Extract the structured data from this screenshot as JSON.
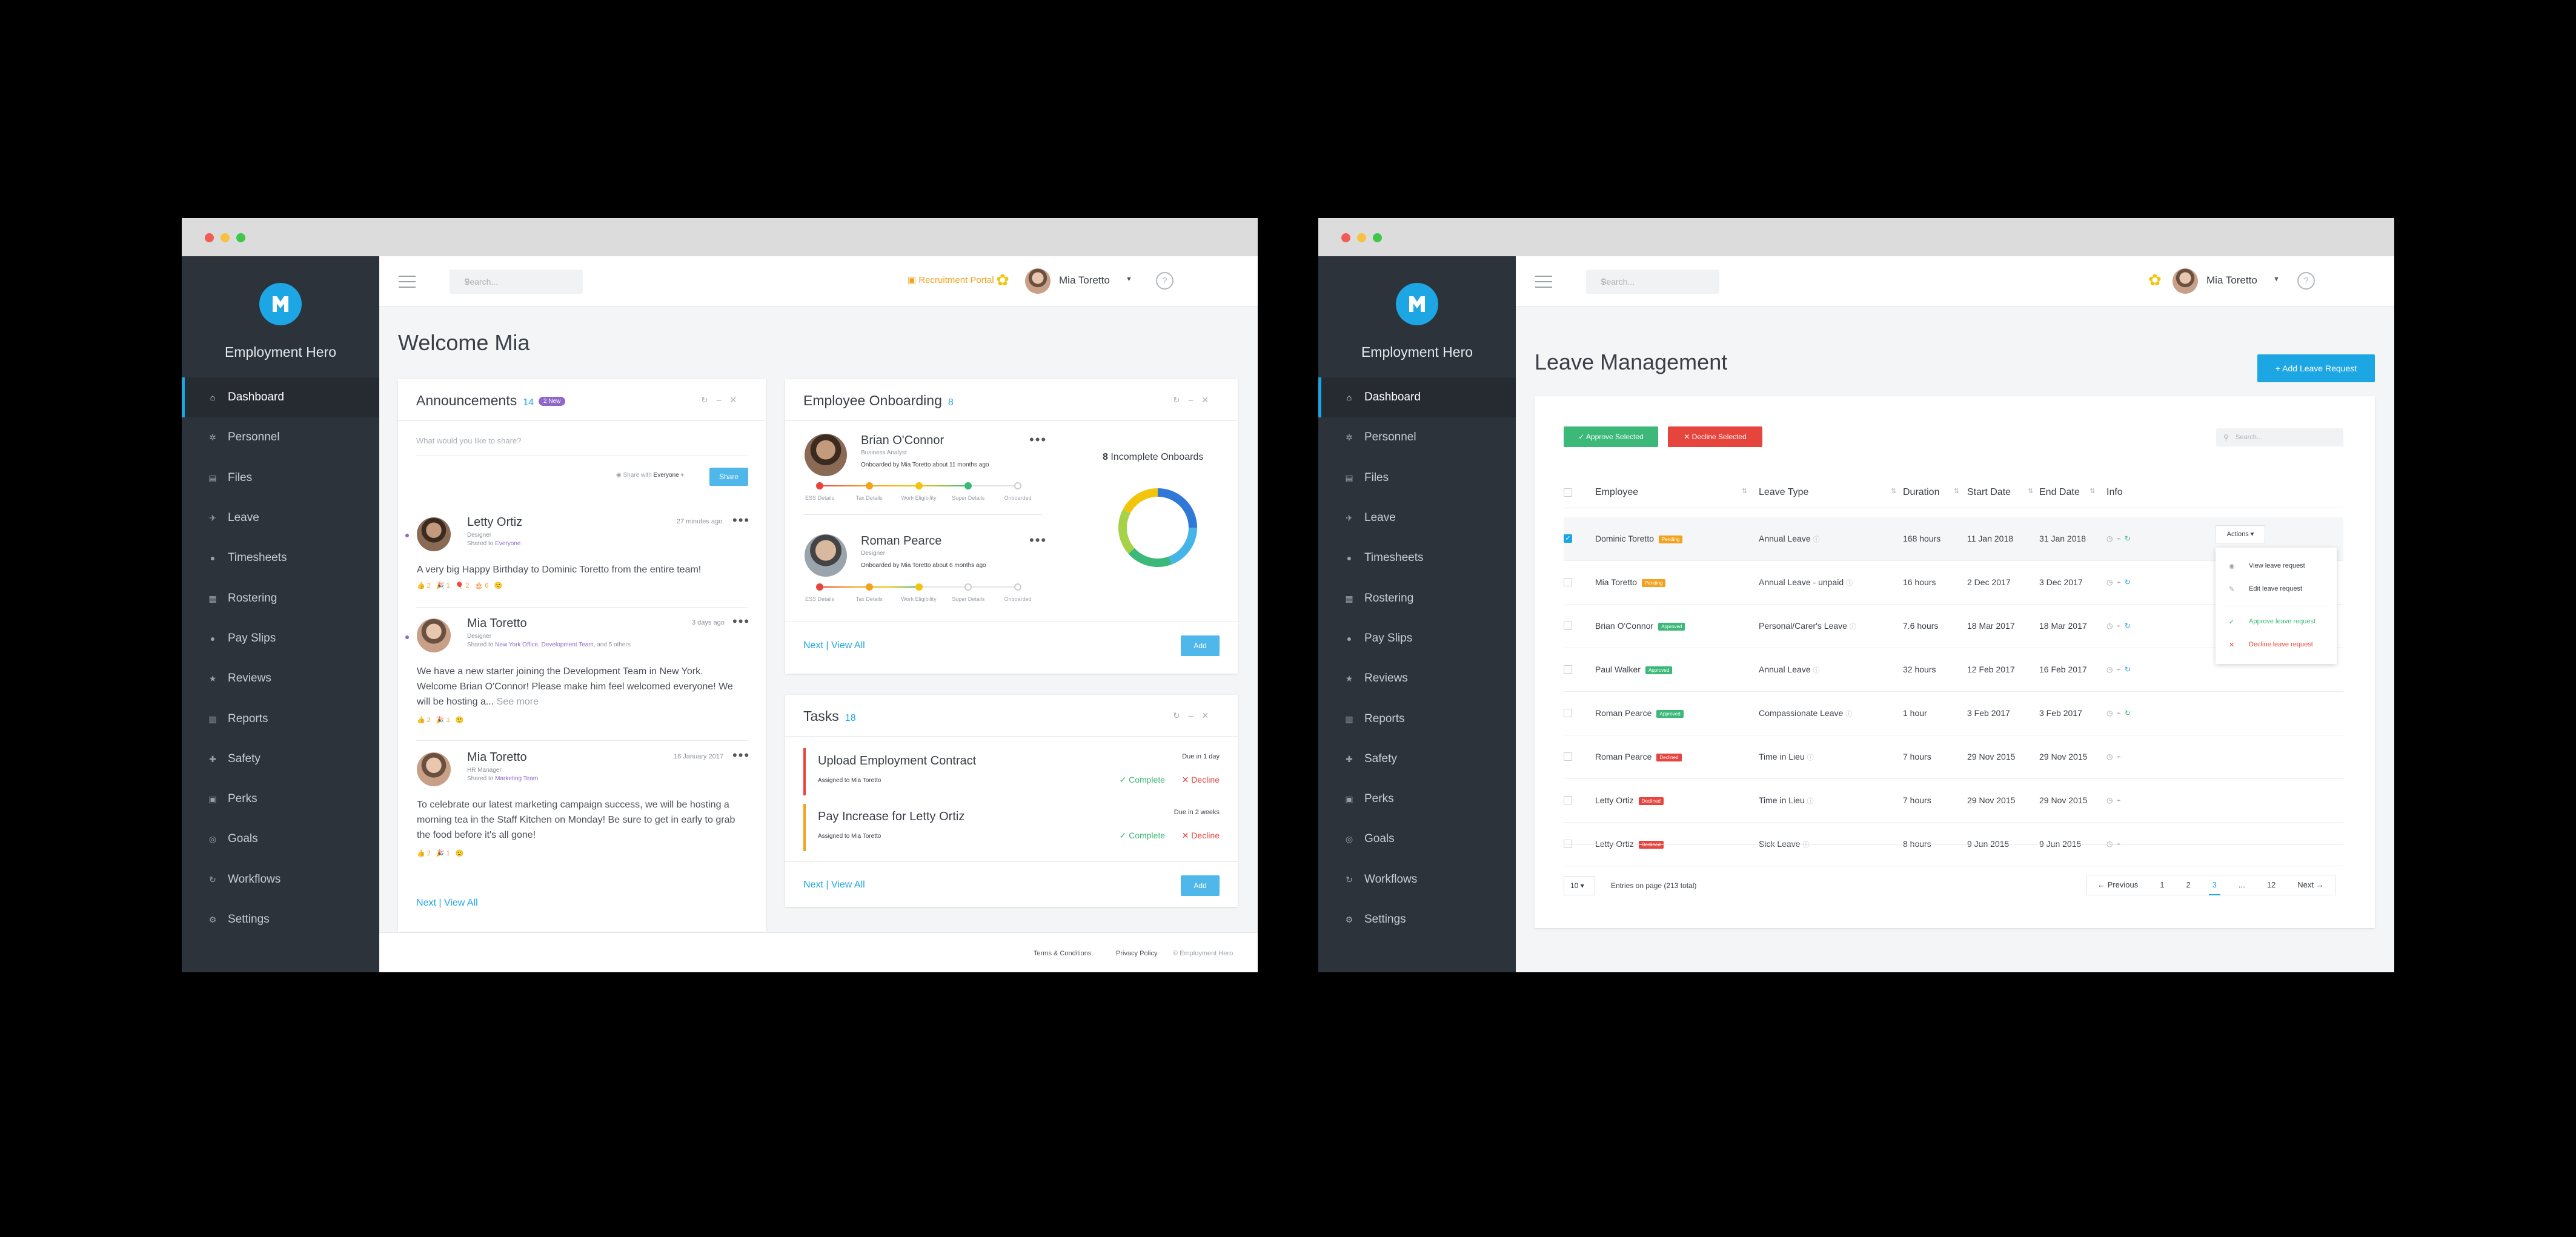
{
  "win1": {
    "brand": "Employment Hero",
    "nav": [
      "Dashboard",
      "Personnel",
      "Files",
      "Leave",
      "Timesheets",
      "Rostering",
      "Pay Slips",
      "Reviews",
      "Reports",
      "Safety",
      "Perks",
      "Goals",
      "Workflows",
      "Settings"
    ],
    "search_placeholder": "Search...",
    "recruit": "Recruitment Portal",
    "user": "Mia Toretto",
    "title": "Welcome Mia",
    "ann": {
      "title": "Announcements",
      "count": "14",
      "badge": "2 New",
      "placeholder": "What would you like to share?",
      "share_with": "Share with",
      "share_target": "Everyone",
      "share_btn": "Share",
      "posts": [
        {
          "name": "Letty Ortiz",
          "role": "Designer",
          "shared": "Shared to",
          "target": "Everyone",
          "time": "27 minutes ago",
          "text": "A very big Happy Birthday to Dominic Toretto from the entire team!",
          "reacts": "👍2 🎉1 🎈2 🎂6 🙂"
        },
        {
          "name": "Mia Toretto",
          "role": "Designer",
          "shared": "Shared to",
          "target": "New York Office, Development Team,",
          "extra": "and 5 others",
          "time": "3 days ago",
          "text1": "We have a new starter joining the Development Team in New York.",
          "text2": "Welcome Brian O'Connor! Please make him feel welcomed everyone! We",
          "text3": "will be hosting a...",
          "more": "See more",
          "reacts": "👍2 🎉1 🙂"
        },
        {
          "name": "Mia Toretto",
          "role": "HR Manager",
          "shared": "Shared to",
          "target": "Marketing Team",
          "time": "16 January 2017",
          "text1": "To celebrate our latest marketing campaign success, we will be hosting a",
          "text2": "morning tea in the Staff Kitchen on Monday! Be sure to get in early to grab",
          "text3": "the food before it's all gone!",
          "reacts": "👍2 🎉1 🙂"
        }
      ],
      "next": "Next",
      "sep": "|",
      "view_all": "View All"
    },
    "onb": {
      "title": "Employee Onboarding",
      "count": "8",
      "people": [
        {
          "name": "Brian O'Connor",
          "role": "Business Analyst",
          "by": "Onboarded by Mia Toretto about 11 months ago",
          "done": 4
        },
        {
          "name": "Roman Pearce",
          "role": "Designer",
          "by": "Onboarded by Mia Toretto about 6 months ago",
          "done": 3
        }
      ],
      "steps": [
        "ESS Details",
        "Tax Details",
        "Work Eligibility",
        "Super Details",
        "Onboarded"
      ],
      "incomplete_num": "8",
      "incomplete_label": "Incomplete Onboards",
      "next": "Next",
      "sep": "|",
      "view_all": "View All",
      "add": "Add"
    },
    "tasks": {
      "title": "Tasks",
      "count": "18",
      "items": [
        {
          "title": "Upload Employment Contract",
          "assigned": "Assigned to Mia Toretto",
          "due": "Due in 1 day",
          "color": "#e6453d"
        },
        {
          "title": "Pay Increase for Letty Ortiz",
          "assigned": "Assigned to Mia Toretto",
          "due": "Due in 2 weeks",
          "color": "#f2a21f"
        }
      ],
      "complete": "Complete",
      "decline": "Decline",
      "next": "Next",
      "sep": "|",
      "view_all": "View All",
      "add": "Add"
    },
    "footer": {
      "terms": "Terms & Conditions",
      "privacy": "Privacy Policy",
      "copy": "© Employment Hero"
    }
  },
  "win2": {
    "brand": "Employment Hero",
    "nav": [
      "Dashboard",
      "Personnel",
      "Files",
      "Leave",
      "Timesheets",
      "Rostering",
      "Pay Slips",
      "Reviews",
      "Reports",
      "Safety",
      "Perks",
      "Goals",
      "Workflows",
      "Settings"
    ],
    "search_placeholder": "Search...",
    "user": "Mia Toretto",
    "title": "Leave Management",
    "add_btn": "+ Add Leave Request",
    "approve": "Approve Selected",
    "decline": "Decline Selected",
    "table_search": "Search...",
    "headers": [
      "Employee",
      "Leave Type",
      "Duration",
      "Start Date",
      "End Date",
      "Info"
    ],
    "rows": [
      {
        "emp": "Dominic Toretto",
        "status": "Pending",
        "type": "Annual Leave",
        "dur": "168 hours",
        "start": "11 Jan 2018",
        "end": "31 Jan 2018",
        "checked": true
      },
      {
        "emp": "Mia Toretto",
        "status": "Pending",
        "type": "Annual Leave - unpaid",
        "dur": "16 hours",
        "start": "2 Dec 2017",
        "end": "3 Dec 2017",
        "checked": false
      },
      {
        "emp": "Brian O'Connor",
        "status": "Approved",
        "type": "Personal/Carer's Leave",
        "dur": "7.6 hours",
        "start": "18 Mar 2017",
        "end": "18 Mar 2017",
        "checked": false
      },
      {
        "emp": "Paul Walker",
        "status": "Approved",
        "type": "Annual Leave",
        "dur": "32 hours",
        "start": "12 Feb 2017",
        "end": "16 Feb 2017",
        "checked": false
      },
      {
        "emp": "Roman Pearce",
        "status": "Approved",
        "type": "Compassionate Leave",
        "dur": "1 hour",
        "start": "3 Feb 2017",
        "end": "3 Feb 2017",
        "checked": false
      },
      {
        "emp": "Roman Pearce",
        "status": "Declined",
        "type": "Time in Lieu",
        "dur": "7 hours",
        "start": "29 Nov 2015",
        "end": "29 Nov 2015",
        "checked": false
      },
      {
        "emp": "Letty Ortiz",
        "status": "Declined",
        "type": "Time in Lieu",
        "dur": "7 hours",
        "start": "29 Nov 2015",
        "end": "29 Nov 2015",
        "checked": false
      },
      {
        "emp": "Letty Ortiz",
        "status": "Declined",
        "type": "Sick Leave",
        "dur": "8 hours",
        "start": "9 Jun 2015",
        "end": "9 Jun 2015",
        "checked": false
      }
    ],
    "actions": "Actions",
    "menu": [
      "View leave request",
      "Edit leave request",
      "Approve leave request",
      "Decline leave request"
    ],
    "page_size": "10",
    "entries": "Entries on page (213 total)",
    "pages": [
      "Previous",
      "1",
      "2",
      "3",
      "...",
      "12",
      "Next"
    ]
  },
  "colors": {
    "accent": "#1da6e4",
    "pending": "#f2a21f",
    "approved": "#3cb878",
    "declined": "#e6453d",
    "purple": "#8e68c9"
  }
}
